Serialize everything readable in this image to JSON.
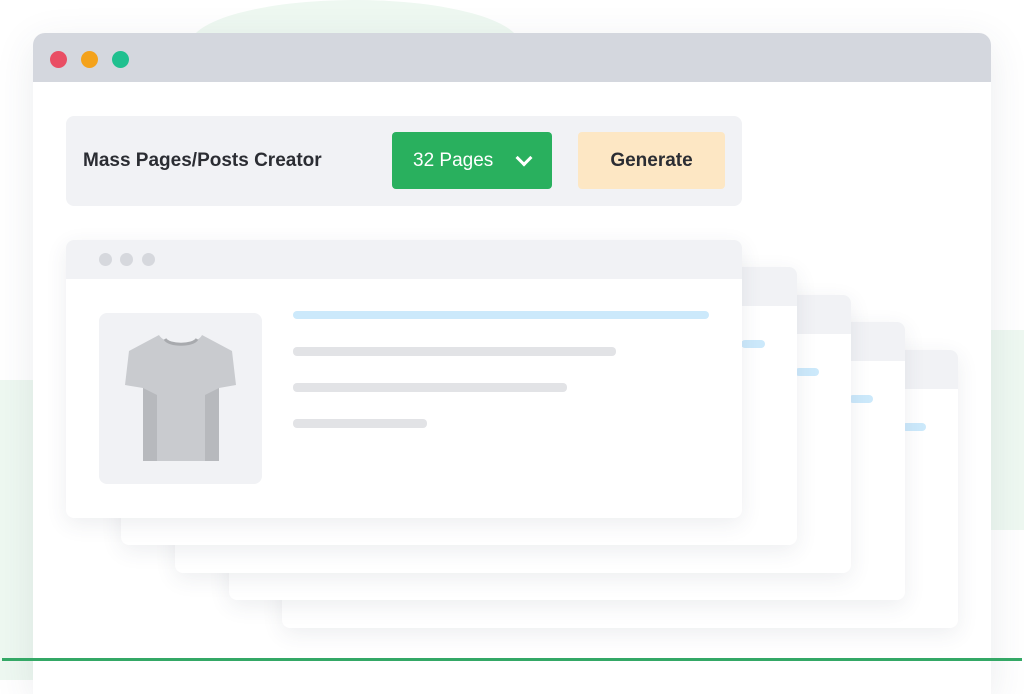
{
  "toolbar": {
    "title": "Mass Pages/Posts Creator",
    "pages_select": {
      "value": "32 Pages",
      "icon": "chevron-down-icon"
    },
    "generate_label": "Generate"
  },
  "window_controls": [
    "close",
    "minimize",
    "maximize"
  ],
  "preview": {
    "stacked_pages_behind": 4,
    "product_icon": "tshirt-icon"
  },
  "colors": {
    "select_green": "#29b05e",
    "generate_bg": "#fde7c4",
    "close_red": "#e94e64",
    "minimize_yellow": "#f4a21b",
    "maximize_green": "#20c08f",
    "accent_blue_line": "#cce9fb",
    "bottom_line": "#34a866"
  }
}
